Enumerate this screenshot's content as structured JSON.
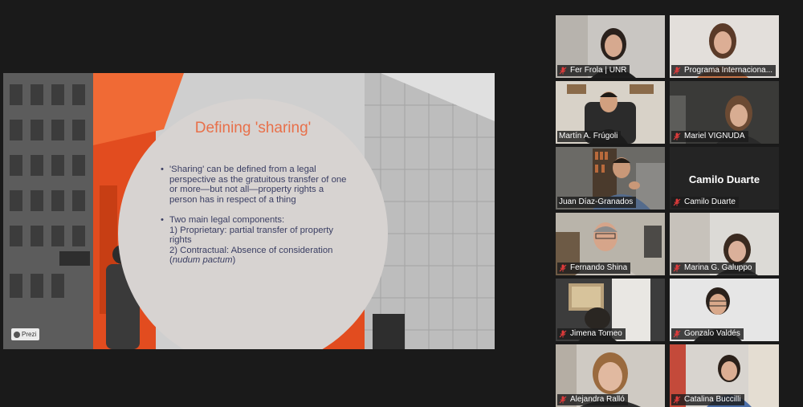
{
  "slide": {
    "title": "Defining 'sharing'",
    "bullet1": [
      "'Sharing' can be defined from a legal",
      "perspective as the gratuitous transfer of one",
      "or more—but not all—property rights a",
      "person has in respect of a thing"
    ],
    "bullet2": {
      "line1": "Two main legal components:",
      "line2": "1) Proprietary: partial transfer of property",
      "line3": "rights",
      "line4": "2) Contractual: Absence of consideration",
      "line5_prefix": "(",
      "line5_italic": "nudum pactum",
      "line5_suffix": ")"
    },
    "badge": "Prezi",
    "colors": {
      "title": "#e8704a",
      "body": "#3a3e63",
      "accent_orange": "#e24c1f",
      "circle": "#d7d3d1"
    }
  },
  "participants": [
    {
      "name": "Fer Frola | UNR",
      "muted": true
    },
    {
      "name": "Programa Internaciona...",
      "muted": true
    },
    {
      "name": "Martín A. Frúgoli",
      "muted": false
    },
    {
      "name": "Mariel VIGNUDA",
      "muted": true
    },
    {
      "name": "Juan Díaz-Granados",
      "muted": false,
      "active_speaker": true
    },
    {
      "name": "Camilo Duarte",
      "muted": true,
      "video_off": true,
      "center_name": "Camilo Duarte"
    },
    {
      "name": "Fernando Shina",
      "muted": true
    },
    {
      "name": "Marina G. Galuppo",
      "muted": true
    },
    {
      "name": "Jimena Tomeo",
      "muted": true
    },
    {
      "name": "Gonzalo Valdés",
      "muted": true
    },
    {
      "name": "Alejandra Ralló",
      "muted": true
    },
    {
      "name": "Catalina Buccilli",
      "muted": true
    }
  ],
  "icons": {
    "muted": "mic-off-icon"
  },
  "colors": {
    "active_speaker_border": "#d7e34a",
    "mic_muted": "#e03b3b",
    "background": "#1a1a1a"
  }
}
